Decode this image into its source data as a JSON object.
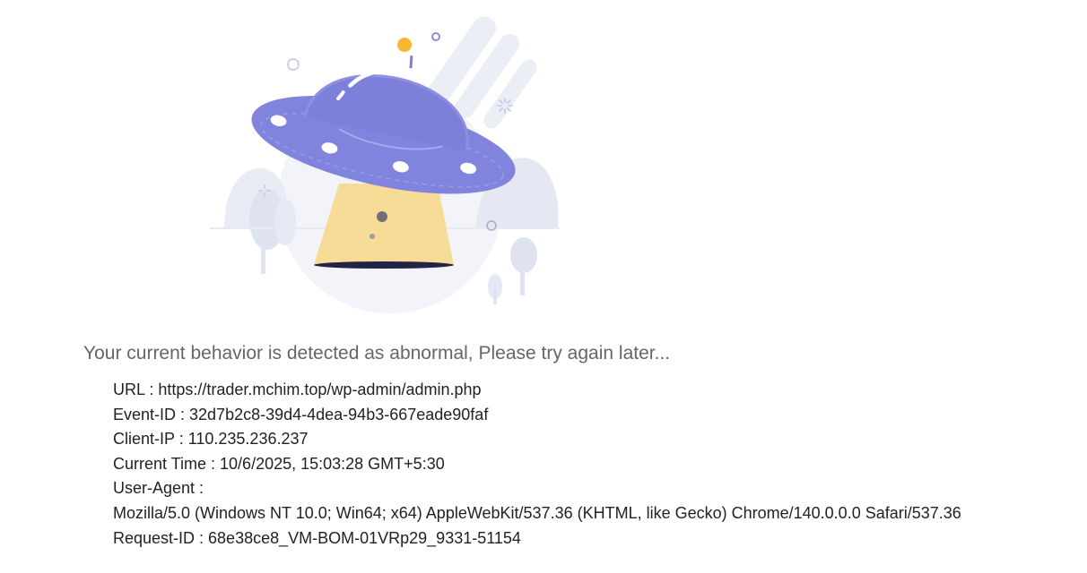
{
  "illustration": {
    "icon": "ufo-illustration",
    "colors": {
      "saucer": "#8184dc",
      "saucer_dark": "#6b6fd0",
      "beam": "#f7dc97",
      "antenna_ball": "#f7b733",
      "background_shapes": "#eef0f7"
    }
  },
  "message": "Your current behavior is detected as abnormal, Please try again later...",
  "details": {
    "url": "URL : https://trader.mchim.top/wp-admin/admin.php",
    "event_id": "Event-ID : 32d7b2c8-39d4-4dea-94b3-667eade90faf",
    "client_ip": "Client-IP : 110.235.236.237",
    "current_time": "Current Time : 10/6/2025, 15:03:28 GMT+5:30",
    "user_agent_label": "User-Agent :",
    "user_agent_value": "Mozilla/5.0 (Windows NT 10.0; Win64; x64) AppleWebKit/537.36 (KHTML, like Gecko) Chrome/140.0.0.0 Safari/537.36",
    "request_id": "Request-ID : 68e38ce8_VM-BOM-01VRp29_9331-51154"
  }
}
